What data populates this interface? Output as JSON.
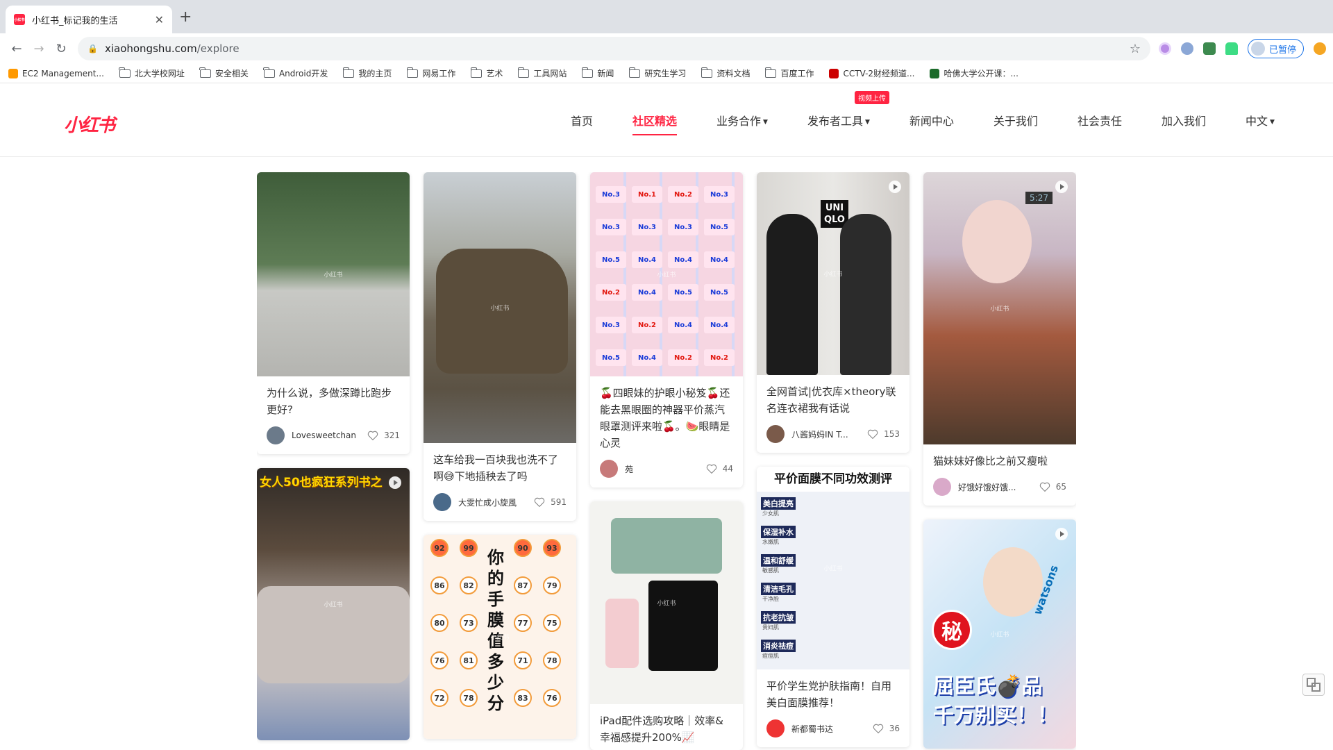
{
  "browser": {
    "tab_title": "小红书_标记我的生活",
    "tab_favicon": "小红书",
    "url_host": "xiaohongshu.com",
    "url_path": "/explore",
    "profile_label": "已暂停"
  },
  "bookmarks": [
    {
      "label": "EC2 Management...",
      "icon": "aws-icon"
    },
    {
      "label": "北大学校网址",
      "icon": "folder-icon"
    },
    {
      "label": "安全相关",
      "icon": "folder-icon"
    },
    {
      "label": "Android开发",
      "icon": "folder-icon"
    },
    {
      "label": "我的主页",
      "icon": "folder-icon"
    },
    {
      "label": "网易工作",
      "icon": "folder-icon"
    },
    {
      "label": "艺术",
      "icon": "folder-icon"
    },
    {
      "label": "工具网站",
      "icon": "folder-icon"
    },
    {
      "label": "新闻",
      "icon": "folder-icon"
    },
    {
      "label": "研究生学习",
      "icon": "folder-icon"
    },
    {
      "label": "资料文档",
      "icon": "folder-icon"
    },
    {
      "label": "百度工作",
      "icon": "folder-icon"
    },
    {
      "label": "CCTV-2财经频道...",
      "icon": "cctv-icon"
    },
    {
      "label": "哈佛大学公开课：...",
      "icon": "video-icon"
    }
  ],
  "site": {
    "logo": "小红书",
    "nav": [
      {
        "label": "首页"
      },
      {
        "label": "社区精选",
        "active": true
      },
      {
        "label": "业务合作",
        "dropdown": true
      },
      {
        "label": "发布者工具",
        "dropdown": true,
        "badge": "视频上传"
      },
      {
        "label": "新闻中心"
      },
      {
        "label": "关于我们"
      },
      {
        "label": "社会责任"
      },
      {
        "label": "加入我们"
      },
      {
        "label": "中文",
        "dropdown": true
      }
    ],
    "watermark": "小红书"
  },
  "cover_text": {
    "c6": "女人50也疯狂系列书之",
    "c7_title": "你的手膜值多少分",
    "c9_header": "平价面膜不同功效测评",
    "c9_rows": [
      "美白提亮",
      "保湿补水",
      "温和舒缓",
      "清洁毛孔",
      "抗老抗皱",
      "消炎祛痘"
    ],
    "c9_rows_sub": [
      "少女肌",
      "水嫩肌",
      "敏感肌",
      "干净脸",
      "贵妇肌",
      "痘痘肌"
    ],
    "c4_brand": "UNI QLO",
    "c5_clock": "5:27",
    "c10_big": "屈臣氏💣品 千万别买！！",
    "c10_secret": "秘",
    "c10_store": "watsons",
    "c3_chips": [
      "No.3",
      "No.1",
      "No.2",
      "No.3",
      "No.3",
      "No.3",
      "No.3",
      "No.5",
      "No.5",
      "No.4",
      "No.4",
      "No.4",
      "No.2",
      "No.4",
      "No.5",
      "No.5",
      "No.3",
      "No.2",
      "No.4",
      "No.4",
      "No.5",
      "No.4",
      "No.2",
      "No.2"
    ],
    "c7_scores": [
      "92",
      "99",
      "90",
      "93",
      "86",
      "82",
      "87",
      "79",
      "80",
      "73",
      "77",
      "75",
      "76",
      "81",
      "71",
      "78",
      "72",
      "78",
      "83",
      "76"
    ]
  },
  "cards": [
    {
      "col": 0,
      "cover": "c1",
      "title": "为什么说，多做深蹲比跑步更好?",
      "author": "Lovesweetchan",
      "likes": "321",
      "video": false,
      "avatar_color": "#6b7a8a"
    },
    {
      "col": 0,
      "cover": "c6",
      "title": "",
      "author": "",
      "likes": "",
      "video": true,
      "avatar_color": "#999"
    },
    {
      "col": 1,
      "cover": "c2",
      "title": "这车给我一百块我也洗不了啊😅下地插秧去了吗",
      "author": "大雯忙成小旋風",
      "likes": "591",
      "video": false,
      "avatar_color": "#4a6a8a"
    },
    {
      "col": 1,
      "cover": "c7",
      "title": "",
      "author": "",
      "likes": "",
      "video": false,
      "avatar_color": "#999"
    },
    {
      "col": 2,
      "cover": "c3",
      "title": "🍒四眼妹的护眼小秘笈🍒还能去黑眼圈的神器平价蒸汽眼罩测评来啦🍒。🍉眼睛是心灵",
      "author": "苑",
      "likes": "44",
      "video": false,
      "avatar_color": "#c77a7a"
    },
    {
      "col": 2,
      "cover": "c8",
      "title": "iPad配件选购攻略｜效率&幸福感提升200%📈",
      "author": "",
      "likes": "",
      "video": false,
      "avatar_color": "#999"
    },
    {
      "col": 3,
      "cover": "c4",
      "title": "全网首试|优衣库×theory联名连衣裙我有话说",
      "author": "八酱妈妈IN T...",
      "likes": "153",
      "video": true,
      "avatar_color": "#7a5a4a"
    },
    {
      "col": 3,
      "cover": "c9",
      "title": "平价学生党护肤指南！自用美白面膜推荐！",
      "author": "新都蜀书达",
      "likes": "36",
      "video": false,
      "avatar_color": "#e33"
    },
    {
      "col": 4,
      "cover": "c5",
      "title": "猫妹妹好像比之前又瘦啦",
      "author": "好饿好饿好饿...",
      "likes": "65",
      "video": true,
      "avatar_color": "#d9a9c9"
    },
    {
      "col": 4,
      "cover": "c10",
      "title": "",
      "author": "",
      "likes": "",
      "video": true,
      "avatar_color": "#999"
    }
  ]
}
